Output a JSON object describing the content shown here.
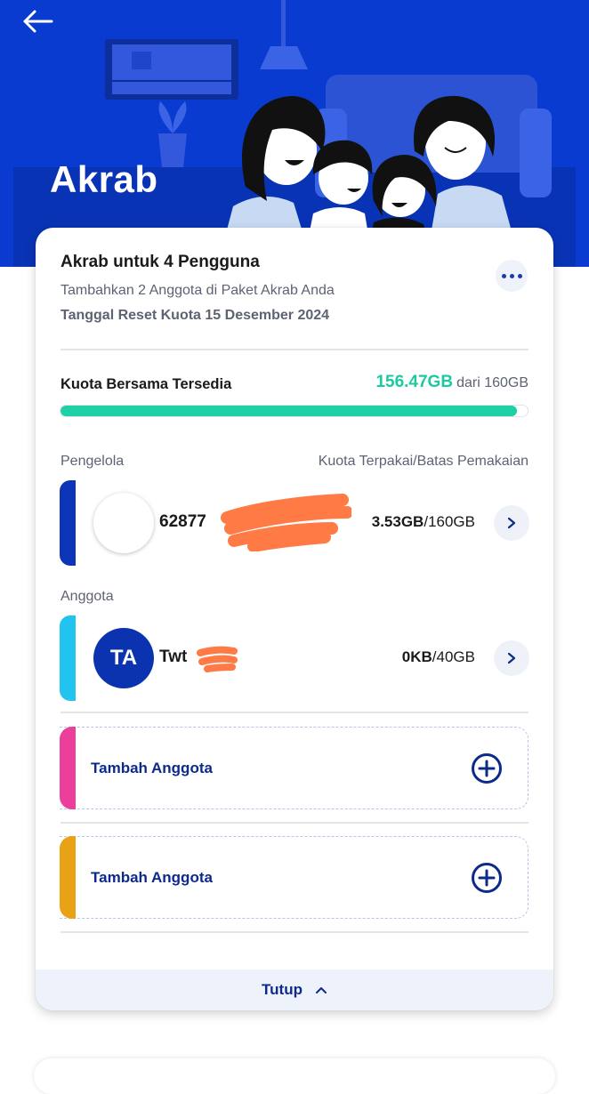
{
  "header": {
    "title": "Akrab"
  },
  "plan": {
    "title": "Akrab untuk 4 Pengguna",
    "subtitle": "Tambahkan 2 Anggota di Paket Akrab Anda",
    "reset_date": "Tanggal Reset Kuota 15 Desember 2024"
  },
  "quota": {
    "label": "Kuota Bersama Tersedia",
    "available": "156.47GB",
    "of_total": "dari 160GB",
    "progress_fraction": 0.978
  },
  "manager": {
    "section_label": "Pengelola",
    "column_header": "Kuota Terpakai/Batas Pemakaian",
    "phone": "62877",
    "used": "3.53GB",
    "limit": "/160GB"
  },
  "members": {
    "section_label": "Anggota",
    "items": [
      {
        "initials": "TA",
        "name": "Twt",
        "used": "0KB",
        "limit": "/40GB"
      }
    ]
  },
  "add_slots": [
    {
      "label": "Tambah Anggota"
    },
    {
      "label": "Tambah Anggota"
    }
  ],
  "footer": {
    "close_label": "Tutup"
  },
  "colors": {
    "brand_blue": "#0a3bd0",
    "quota_green": "#1dc9a0",
    "manager_accent": "#0c35b8",
    "member_accent": "#22c3ee",
    "slot1_accent": "#ec3f9b",
    "slot2_accent": "#e8a215",
    "redaction": "#ff7a45"
  }
}
